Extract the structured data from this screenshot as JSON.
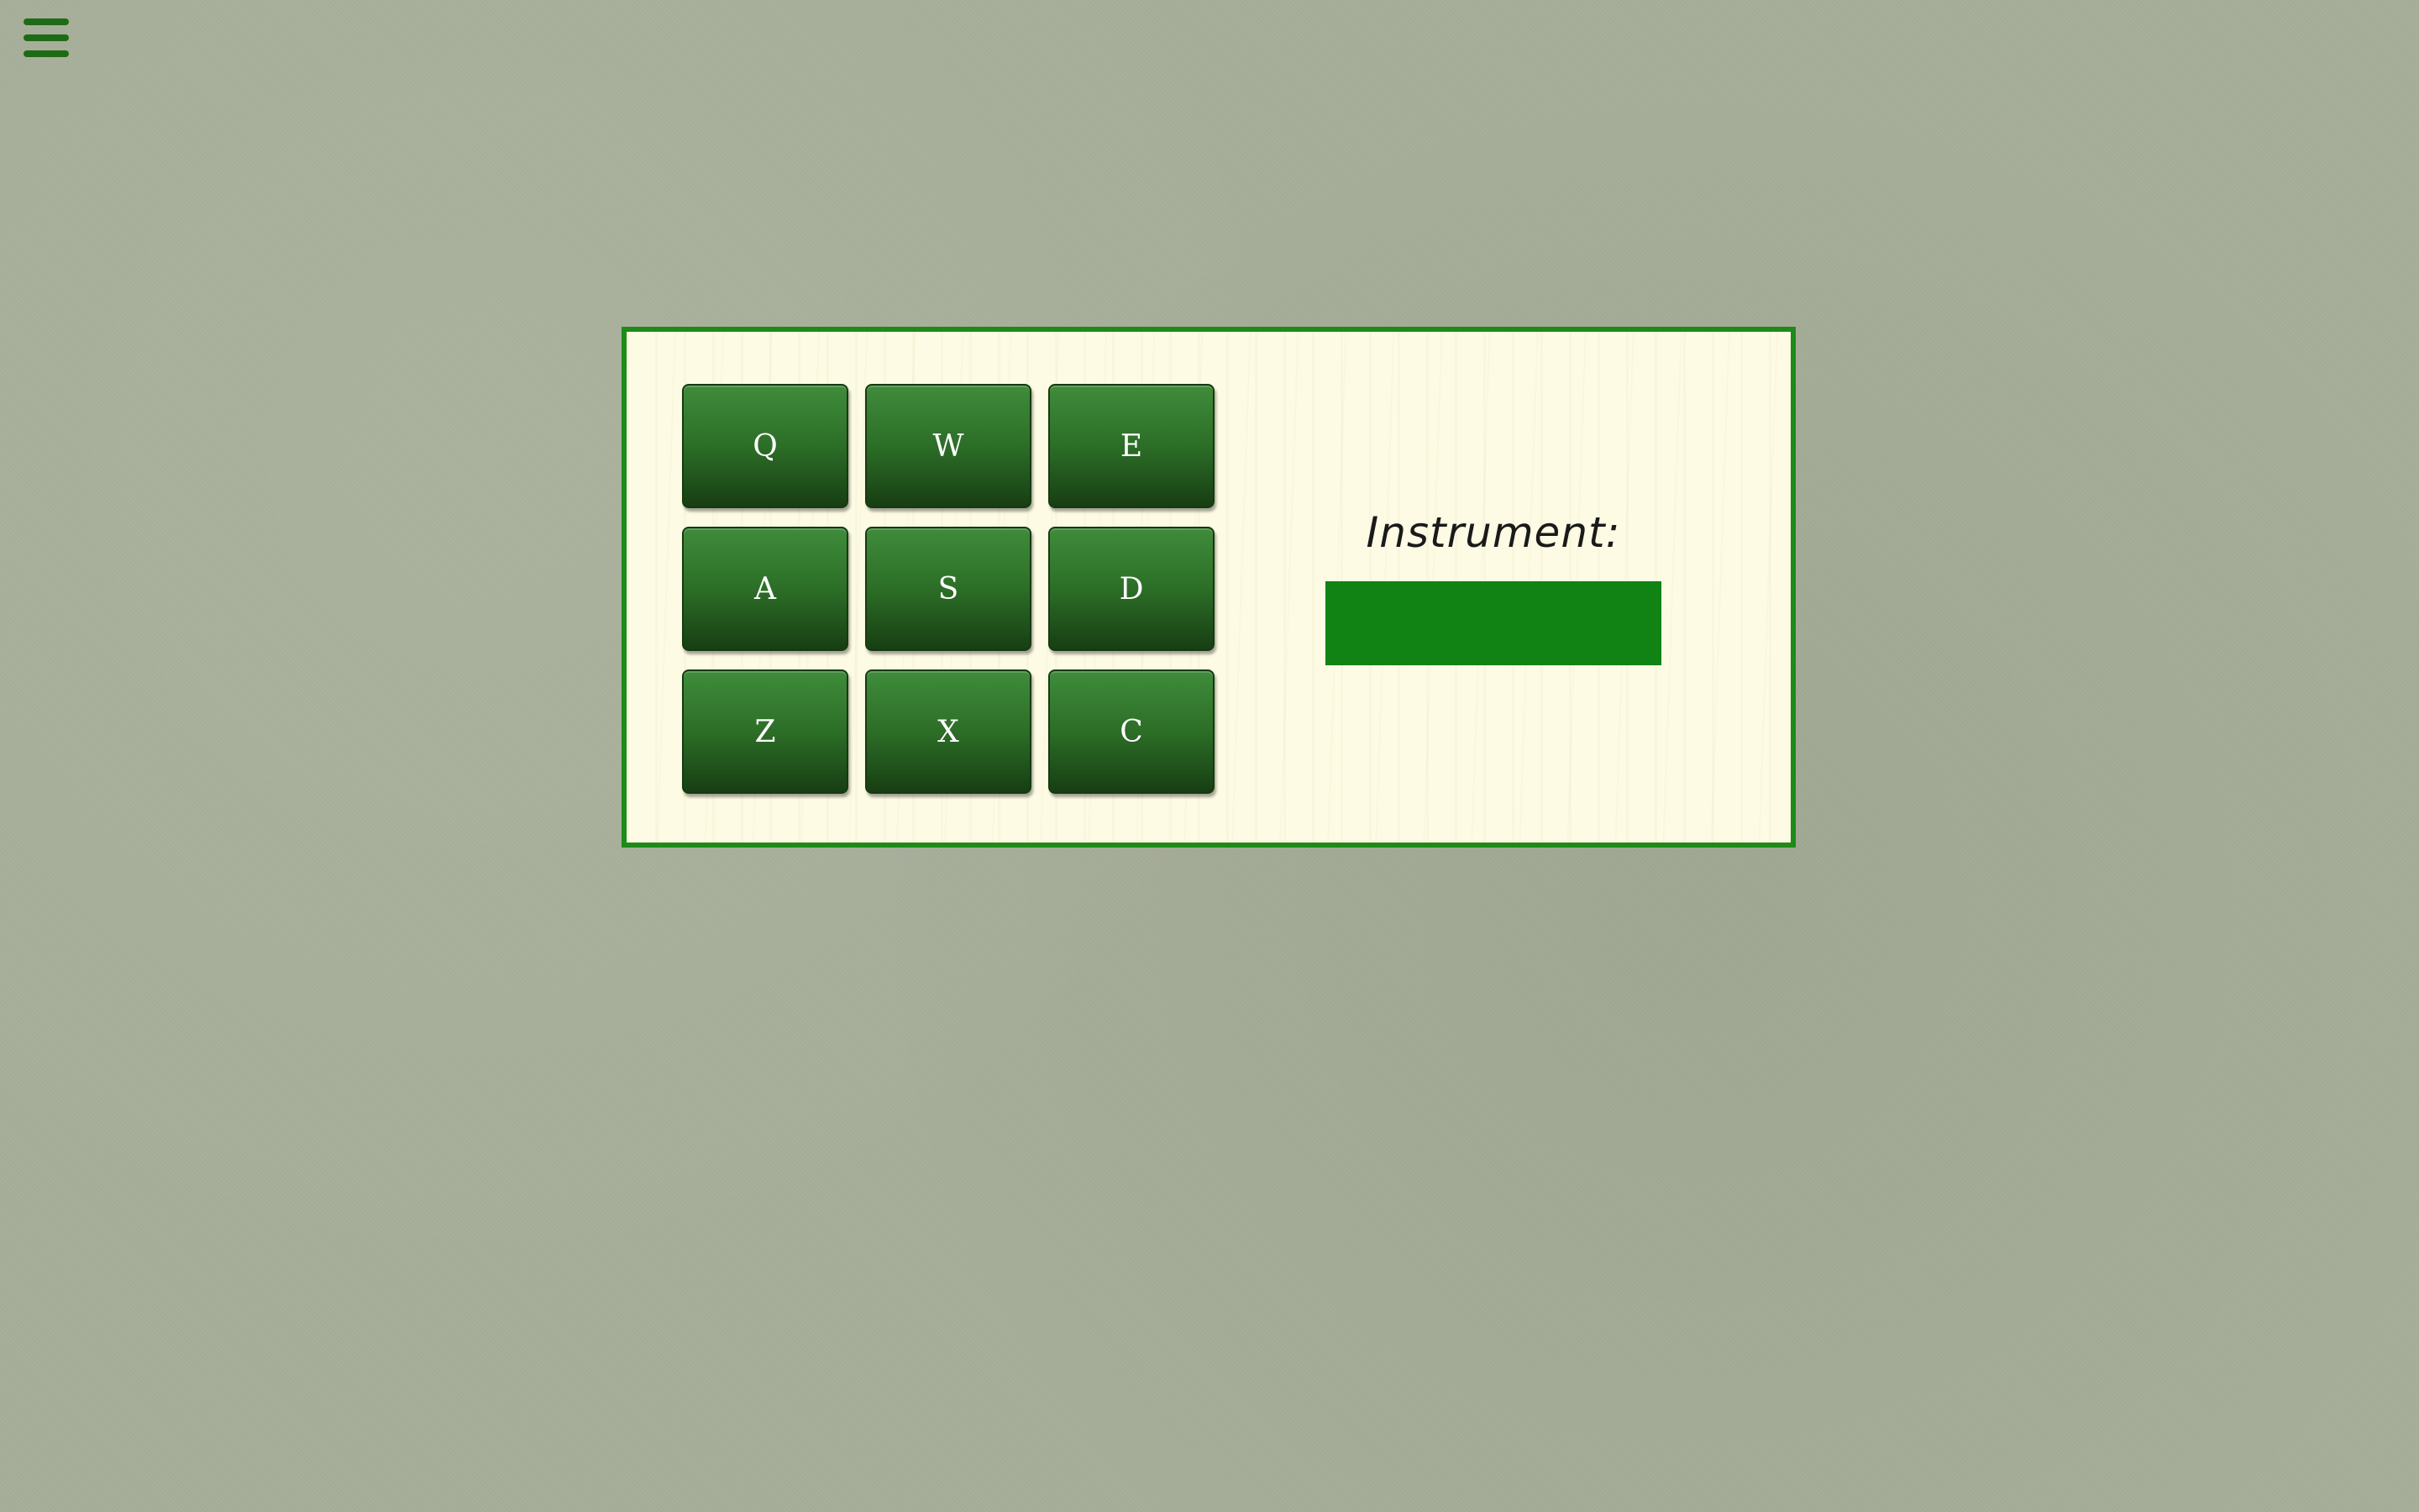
{
  "menu": {
    "icon": "hamburger-menu-icon",
    "color": "#1f6a14"
  },
  "pads": [
    {
      "key": "Q"
    },
    {
      "key": "W"
    },
    {
      "key": "E"
    },
    {
      "key": "A"
    },
    {
      "key": "S"
    },
    {
      "key": "D"
    },
    {
      "key": "Z"
    },
    {
      "key": "X"
    },
    {
      "key": "C"
    }
  ],
  "instrument": {
    "label": "Instrument:",
    "display_value": ""
  },
  "colors": {
    "background": "#a6ae99",
    "panel_border": "#1e8a19",
    "panel_background": "#fdfbe3",
    "pad": "#2c6e27",
    "display": "#118214"
  }
}
